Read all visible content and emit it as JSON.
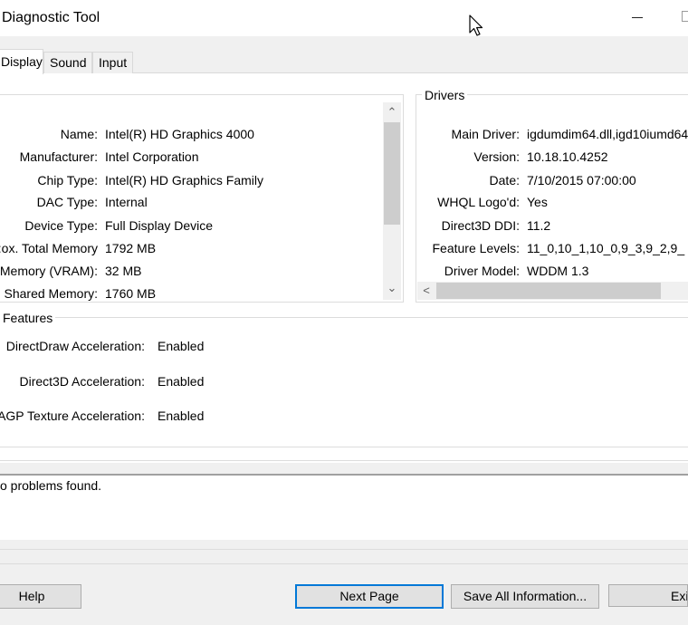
{
  "window": {
    "title": "Diagnostic Tool"
  },
  "tabs": [
    {
      "label": "Display"
    },
    {
      "label": "Sound"
    },
    {
      "label": "Input"
    }
  ],
  "device": {
    "rows": [
      {
        "label": "Name:",
        "value": "Intel(R) HD Graphics 4000"
      },
      {
        "label": "Manufacturer:",
        "value": "Intel Corporation"
      },
      {
        "label": "Chip Type:",
        "value": "Intel(R) HD Graphics Family"
      },
      {
        "label": "DAC Type:",
        "value": "Internal"
      },
      {
        "label": "Device Type:",
        "value": "Full Display Device"
      },
      {
        "label": "ox. Total Memory:",
        "value": "1792 MB"
      },
      {
        "label": "Memory (VRAM):",
        "value": "32 MB"
      },
      {
        "label": "Shared Memory:",
        "value": "1760 MB"
      }
    ]
  },
  "drivers": {
    "title": "Drivers",
    "rows": [
      {
        "label": "Main Driver:",
        "value": "igdumdim64.dll,igd10iumd64."
      },
      {
        "label": "Version:",
        "value": "10.18.10.4252"
      },
      {
        "label": "Date:",
        "value": "7/10/2015 07:00:00"
      },
      {
        "label": "WHQL Logo'd:",
        "value": "Yes"
      },
      {
        "label": "Direct3D DDI:",
        "value": "11.2"
      },
      {
        "label": "Feature Levels:",
        "value": "11_0,10_1,10_0,9_3,9_2,9_"
      },
      {
        "label": "Driver Model:",
        "value": "WDDM 1.3"
      }
    ]
  },
  "features": {
    "title": "Features",
    "rows": [
      {
        "label": "DirectDraw Acceleration:",
        "value": "Enabled"
      },
      {
        "label": "Direct3D Acceleration:",
        "value": "Enabled"
      },
      {
        "label": "AGP Texture Acceleration:",
        "value": "Enabled"
      }
    ]
  },
  "notes": {
    "text": "o problems found."
  },
  "buttons": {
    "help": "Help",
    "next_page": "Next Page",
    "save_all": "Save All Information...",
    "exit": "Exit"
  },
  "scroll_arrows": {
    "up": "⌃",
    "down": "⌄",
    "left": "<"
  },
  "icons": {
    "minimize": "minimize-icon",
    "maximize": "maximize-icon",
    "cursor": "mouse-pointer-icon"
  },
  "colors": {
    "accent": "#0078d7"
  }
}
